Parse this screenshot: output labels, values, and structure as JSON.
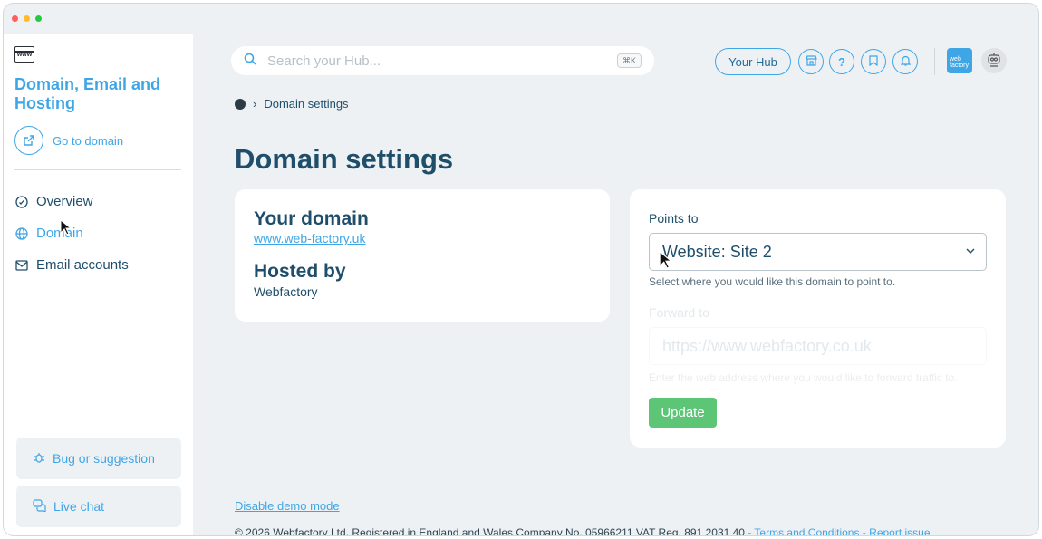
{
  "window": {
    "dots": [
      "#ff5f57",
      "#ffbd2e",
      "#28c840"
    ]
  },
  "sidebar": {
    "brand_icon_text": "www",
    "title": "Domain, Email and Hosting",
    "goto_label": "Go to domain",
    "items": [
      {
        "label": "Overview",
        "icon": "shield-icon"
      },
      {
        "label": "Domain",
        "icon": "globe-icon",
        "active": true
      },
      {
        "label": "Email accounts",
        "icon": "envelope-icon"
      }
    ],
    "bug_label": "Bug or suggestion",
    "chat_label": "Live chat"
  },
  "header": {
    "search_placeholder": "Search your Hub...",
    "search_shortcut": "⌘K",
    "hub_label": "Your Hub",
    "logo_text": "web factory"
  },
  "breadcrumb": {
    "current": "Domain settings"
  },
  "page": {
    "title": "Domain settings",
    "domain_heading": "Your domain",
    "domain_link": "www.web-factory.uk",
    "hosted_heading": "Hosted by",
    "hosted_value": "Webfactory",
    "points_label": "Points to",
    "points_value": "Website: Site 2",
    "points_help": "Select where you would like this domain to point to.",
    "forward_label": "Forward to",
    "forward_placeholder": "https://www.webfactory.co.uk",
    "forward_help": "Enter the web address where you would like to forward traffic to.",
    "update_label": "Update"
  },
  "footer": {
    "demo_link": "Disable demo mode",
    "copyright": "© 2026 Webfactory Ltd. Registered in England and Wales Company No. 05966211 VAT Reg. 891 2031 40 - ",
    "terms": "Terms and Conditions",
    "sep": " - ",
    "report": "Report issue"
  },
  "colors": {
    "accent": "#3fa6e6",
    "navy": "#1f4e6b",
    "success": "#5cc576"
  }
}
